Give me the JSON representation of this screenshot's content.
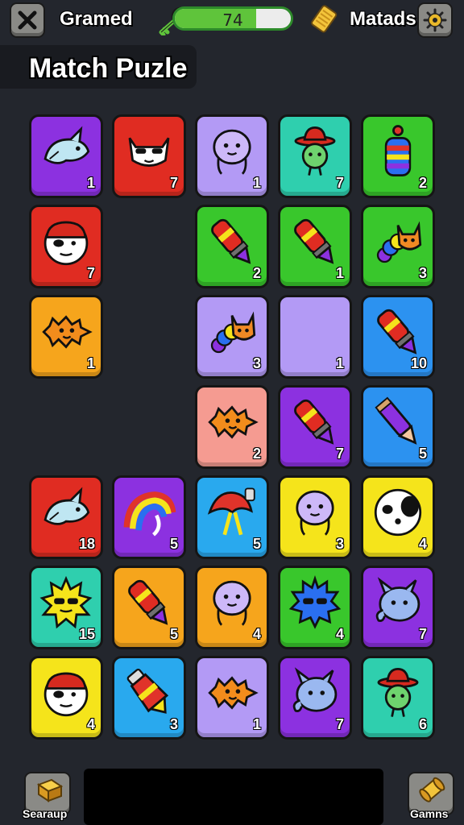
{
  "header": {
    "close_icon": "close-icon",
    "left_label": "Gramed",
    "key_icon": "key-icon",
    "progress_value": 74,
    "progress_fraction": 0.7,
    "ticket_icon": "ticket-icon",
    "right_label": "Matads",
    "settings_icon": "gear-icon"
  },
  "title": "Match Puzle",
  "tiles": [
    {
      "row": 0,
      "col": 0,
      "color": "#8c31e0",
      "icon": "whale-icon",
      "number": "1"
    },
    {
      "row": 0,
      "col": 1,
      "color": "#e02c22",
      "icon": "cool-cat-icon",
      "number": "7"
    },
    {
      "row": 0,
      "col": 2,
      "color": "#b39af5",
      "icon": "blob-creature-icon",
      "number": "1"
    },
    {
      "row": 0,
      "col": 3,
      "color": "#2fcfae",
      "icon": "hat-alien-icon",
      "number": "7"
    },
    {
      "row": 0,
      "col": 4,
      "color": "#39c72c",
      "icon": "striped-bottle-icon",
      "number": "2"
    },
    {
      "row": 1,
      "col": 0,
      "color": "#e02c22",
      "icon": "pirate-face-icon",
      "number": "7"
    },
    {
      "row": 1,
      "col": 2,
      "color": "#39c72c",
      "icon": "rocket-pencil-icon",
      "number": "2"
    },
    {
      "row": 1,
      "col": 3,
      "color": "#39c72c",
      "icon": "rocket-pencil-icon",
      "number": "1"
    },
    {
      "row": 1,
      "col": 4,
      "color": "#39c72c",
      "icon": "fox-caterpillar-icon",
      "number": "3"
    },
    {
      "row": 2,
      "col": 0,
      "color": "#f6a51c",
      "icon": "spiky-fish-icon",
      "number": "1"
    },
    {
      "row": 2,
      "col": 2,
      "color": "#b39af5",
      "icon": "fox-caterpillar-icon",
      "number": "3"
    },
    {
      "row": 2,
      "col": 3,
      "color": "#b39af5",
      "icon": "empty",
      "number": "1"
    },
    {
      "row": 2,
      "col": 4,
      "color": "#2c92f0",
      "icon": "rocket-pencil-icon",
      "number": "10"
    },
    {
      "row": 3,
      "col": 2,
      "color": "#f59b91",
      "icon": "spiky-fish-icon",
      "number": "2"
    },
    {
      "row": 3,
      "col": 3,
      "color": "#8c31e0",
      "icon": "rocket-pencil-icon",
      "number": "7"
    },
    {
      "row": 3,
      "col": 4,
      "color": "#2c92f0",
      "icon": "pencil-icon",
      "number": "5"
    },
    {
      "row": 4,
      "col": 0,
      "color": "#e02c22",
      "icon": "whale-icon",
      "number": "18"
    },
    {
      "row": 4,
      "col": 1,
      "color": "#8c31e0",
      "icon": "rainbow-arch-icon",
      "number": "5"
    },
    {
      "row": 4,
      "col": 2,
      "color": "#29a9ee",
      "icon": "umbrella-creature-icon",
      "number": "5"
    },
    {
      "row": 4,
      "col": 3,
      "color": "#f5e41b",
      "icon": "blob-creature-icon",
      "number": "3"
    },
    {
      "row": 4,
      "col": 4,
      "color": "#f5e41b",
      "icon": "panda-face-icon",
      "number": "4"
    },
    {
      "row": 5,
      "col": 0,
      "color": "#2fcfae",
      "icon": "sun-sunglasses-icon",
      "number": "15"
    },
    {
      "row": 5,
      "col": 1,
      "color": "#f6a51c",
      "icon": "rocket-pencil-icon",
      "number": "5"
    },
    {
      "row": 5,
      "col": 2,
      "color": "#f6a51c",
      "icon": "blob-creature-icon",
      "number": "4"
    },
    {
      "row": 5,
      "col": 3,
      "color": "#39c72c",
      "icon": "spiky-ball-icon",
      "number": "4"
    },
    {
      "row": 5,
      "col": 4,
      "color": "#8c31e0",
      "icon": "elephant-icon",
      "number": "7"
    },
    {
      "row": 6,
      "col": 0,
      "color": "#f5e41b",
      "icon": "pirate-face-icon",
      "number": "4"
    },
    {
      "row": 6,
      "col": 1,
      "color": "#29a9ee",
      "icon": "paint-tube-icon",
      "number": "3"
    },
    {
      "row": 6,
      "col": 2,
      "color": "#b39af5",
      "icon": "spiky-fish-icon",
      "number": "1"
    },
    {
      "row": 6,
      "col": 3,
      "color": "#8c31e0",
      "icon": "elephant-icon",
      "number": "7"
    },
    {
      "row": 6,
      "col": 4,
      "color": "#2fcfae",
      "icon": "hat-alien-icon",
      "number": "6"
    }
  ],
  "footer": {
    "left_icon": "gold-bar-icon",
    "left_label": "Searaup",
    "right_icon": "scroll-icon",
    "right_label": "Gamns"
  }
}
